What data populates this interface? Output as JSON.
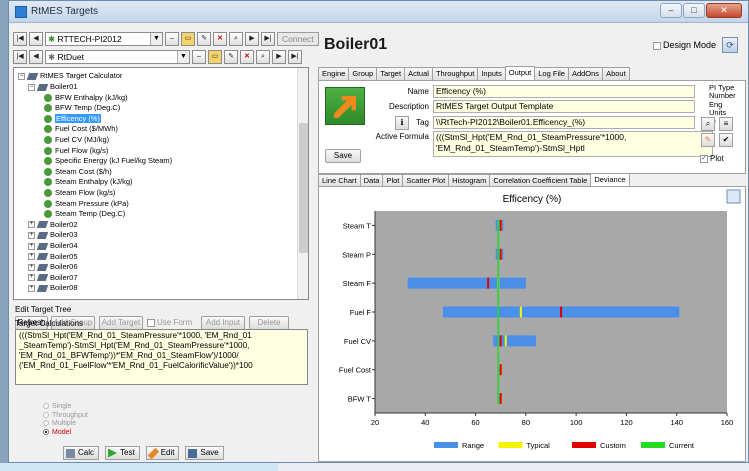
{
  "window": {
    "title": "RtMES Targets",
    "controls": {
      "minimize": "–",
      "maximize": "□",
      "close": "✕"
    }
  },
  "left": {
    "server_combo": "RTTECH-PI2012",
    "connect_label": "Connect",
    "db_combo": "RtDuet",
    "tree": {
      "root": "RtMES Target Calculator",
      "items": [
        {
          "label": "Boiler01",
          "kind": "node",
          "level": 1,
          "expanded": true
        },
        {
          "label": "BFW Enthalpy (kJ/kg)",
          "kind": "leaf",
          "level": 2
        },
        {
          "label": "BFW Temp (Deg.C)",
          "kind": "leaf",
          "level": 2
        },
        {
          "label": "Efficency (%)",
          "kind": "leaf",
          "level": 2,
          "selected": true
        },
        {
          "label": "Fuel Cost ($/MWh)",
          "kind": "leaf",
          "level": 2
        },
        {
          "label": "Fuel CV (MJ/kg)",
          "kind": "leaf",
          "level": 2
        },
        {
          "label": "Fuel Flow (kg/s)",
          "kind": "leaf",
          "level": 2
        },
        {
          "label": "Specific Energy (kJ Fuel/kg Steam)",
          "kind": "leaf",
          "level": 2
        },
        {
          "label": "Steam Cost ($/h)",
          "kind": "leaf",
          "level": 2
        },
        {
          "label": "Steam Enthalpy (kJ/kg)",
          "kind": "leaf",
          "level": 2
        },
        {
          "label": "Steam Flow (kg/s)",
          "kind": "leaf",
          "level": 2
        },
        {
          "label": "Steam Pressure (kPa)",
          "kind": "leaf",
          "level": 2
        },
        {
          "label": "Steam Temp (Deg.C)",
          "kind": "leaf",
          "level": 2
        },
        {
          "label": "Boiler02",
          "kind": "node",
          "level": 1
        },
        {
          "label": "Boiler03",
          "kind": "node",
          "level": 1
        },
        {
          "label": "Boiler04",
          "kind": "node",
          "level": 1
        },
        {
          "label": "Boiler05",
          "kind": "node",
          "level": 1
        },
        {
          "label": "Boiler06",
          "kind": "node",
          "level": 1
        },
        {
          "label": "Boiler07",
          "kind": "node",
          "level": 1
        },
        {
          "label": "Boiler08",
          "kind": "node",
          "level": 1
        }
      ]
    },
    "edit_tree_label": "Edit Target Tree",
    "buttons": {
      "refresh": "Refresh",
      "add_group": "Add Group",
      "add_target": "Add Target",
      "use_form": "Use Form",
      "add_input": "Add Input",
      "delete": "Delete"
    },
    "target_calc_label": "Target Calculations",
    "target_calc_text": "(((StmSl_Hpt('EM_Rnd_01_SteamPressure'*1000, 'EM_Rnd_01\n_SteamTemp')-StmSl_Hpt('EM_Rnd_01_SteamPressure'*1000,\n'EM_Rnd_01_BFWTemp'))*'EM_Rnd_01_SteamFlow')/1000/\n('EM_Rnd_01_FuelFlow'*'EM_Rnd_01_FuelCalorificValue'))*100",
    "radios": [
      {
        "label": "Single",
        "checked": false
      },
      {
        "label": "Throughput",
        "checked": false
      },
      {
        "label": "Multiple",
        "checked": false
      },
      {
        "label": "Model",
        "checked": true
      }
    ],
    "actions": {
      "calc": "Calc",
      "test": "Test",
      "edit": "Edit",
      "save": "Save"
    }
  },
  "right": {
    "title": "Boiler01",
    "design_mode_label": "Design Mode",
    "tabs": [
      "Engine",
      "Group",
      "Target",
      "Actual",
      "Throughput",
      "Inputs",
      "Output",
      "Log File",
      "AddOns",
      "About"
    ],
    "active_tab": "Output",
    "output": {
      "name_label": "Name",
      "name_value": "Efficency (%)",
      "description_label": "Description",
      "description_value": "RtMES Target Output Template",
      "tag_label": "Tag",
      "tag_value": "\\\\RtTech-PI2012\\Boiler01.Efficency_(%)",
      "formula_label": "Active Formula",
      "formula_value": "(((StmSl_Hpt('EM_Rnd_01_SteamPressure'*1000,\n'EM_Rnd_01_SteamTemp')-StmSl_Hptl",
      "save_label": "Save",
      "pi_type_label": "PI Type",
      "pi_type_value": "Number",
      "eng_units_label": "Eng Units",
      "eng_units_value": "%",
      "plot_label": "Plot"
    },
    "chart_tabs": [
      "Line Chart",
      "Data",
      "Plot",
      "Scatter Plot",
      "Histogram",
      "Correlation Coefficient Table",
      "Deviance"
    ],
    "active_chart_tab": "Deviance",
    "colors": {
      "range": "#4a90e8",
      "typical": "#f5f500",
      "custom": "#e00000",
      "current": "#22dd22",
      "plot_bg": "#a8a8a8"
    }
  },
  "chart_data": {
    "type": "bar",
    "title": "Efficency (%)",
    "orientation": "horizontal",
    "categories": [
      "Steam T",
      "Steam P",
      "Steam F",
      "Fuel F",
      "Fuel CV",
      "Fuel Cost",
      "BFW T"
    ],
    "xlim": [
      20,
      160
    ],
    "xticks": [
      20,
      40,
      60,
      80,
      100,
      120,
      140,
      160
    ],
    "grid": false,
    "legend_position": "bottom",
    "series": [
      {
        "name": "Range",
        "values": [
          [
            68,
            71
          ],
          [
            68,
            71
          ],
          [
            33,
            80
          ],
          [
            47,
            141
          ],
          [
            67,
            84
          ],
          [
            69,
            69
          ],
          [
            69,
            70
          ]
        ]
      },
      {
        "name": "Typical",
        "values": [
          70,
          70,
          69,
          78,
          72,
          70,
          70
        ]
      },
      {
        "name": "Custom",
        "values": [
          70,
          70,
          65,
          94,
          70,
          70,
          70
        ]
      },
      {
        "name": "Current",
        "values": [
          69,
          69,
          69,
          69,
          69,
          69,
          69
        ]
      }
    ]
  }
}
